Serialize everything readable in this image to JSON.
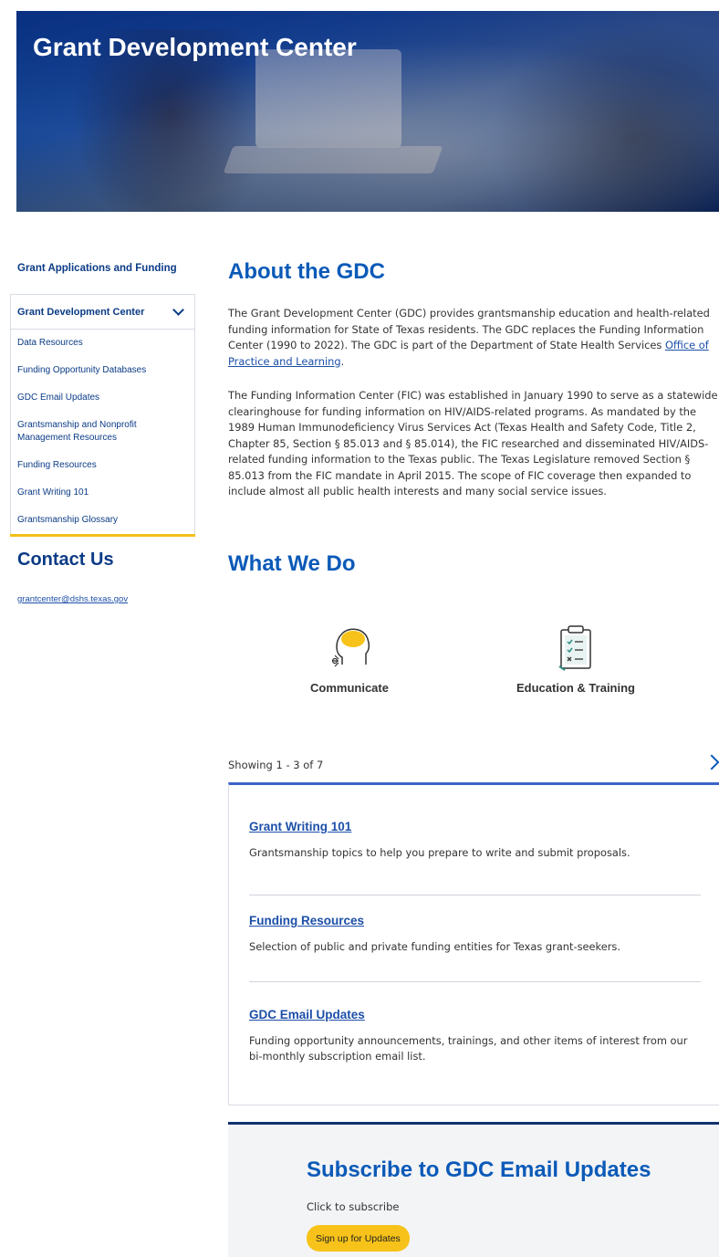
{
  "hero": {
    "title": "Grant Development Center"
  },
  "sidebar": {
    "heading": "Grant Applications and Funding",
    "nav_header": "Grant Development Center",
    "items": [
      {
        "label": "Data Resources"
      },
      {
        "label": "Funding Opportunity Databases"
      },
      {
        "label": "GDC Email Updates"
      },
      {
        "label": "Grantsmanship and Nonprofit Management Resources"
      },
      {
        "label": "Funding Resources"
      },
      {
        "label": "Grant Writing 101"
      },
      {
        "label": "Grantsmanship Glossary"
      }
    ],
    "contact_title": "Contact Us",
    "contact_email": "grantcenter@dshs.texas.gov"
  },
  "about": {
    "title": "About the GDC",
    "p1_text": "The Grant Development Center (GDC) provides grantsmanship education and health-related funding information for State of Texas residents. The GDC replaces the Funding Information Center (1990 to 2022). The GDC is part of the Department of State Health Services ",
    "p1_link": "Office of Practice and Learning",
    "p1_end": ".",
    "p2_text": "The Funding Information Center (FIC) was established in January 1990 to serve as a statewide clearinghouse for funding information on HIV/AIDS-related programs. As mandated by the 1989 Human Immunodeficiency Virus Services Act (Texas Health and Safety Code, Title 2, Chapter 85, Section § 85.013 and § 85.014), the FIC researched and disseminated HIV/AIDS-related funding information to the Texas public.  The Texas Legislature removed Section § 85.013 from the FIC mandate in April 2015.  The scope of FIC coverage then expanded to include almost all public health interests and many social service issues."
  },
  "what_we_do": {
    "title": "What We Do",
    "services": [
      {
        "label": "Communicate",
        "icon": "head-brain-icon"
      },
      {
        "label": "Education & Training",
        "icon": "clipboard-checklist-icon"
      }
    ]
  },
  "carousel": {
    "showing": "Showing 1 - 3 of 7",
    "cards": [
      {
        "title": "Grant Writing 101",
        "desc": "Grantsmanship topics to help you prepare to write and submit proposals."
      },
      {
        "title": "Funding Resources",
        "desc": "Selection of public and private funding entities for Texas grant-seekers."
      },
      {
        "title": "GDC Email Updates",
        "desc": "Funding opportunity announcements, trainings, and other items of interest from our bi-monthly subscription email list."
      }
    ]
  },
  "subscribe": {
    "title": "Subscribe to GDC Email Updates",
    "text": "Click to subscribe",
    "button": "Sign up for Updates"
  },
  "colors": {
    "brand_blue": "#0b5ab8",
    "nav_blue": "#0b3b86",
    "accent_yellow": "#f7c31a"
  }
}
